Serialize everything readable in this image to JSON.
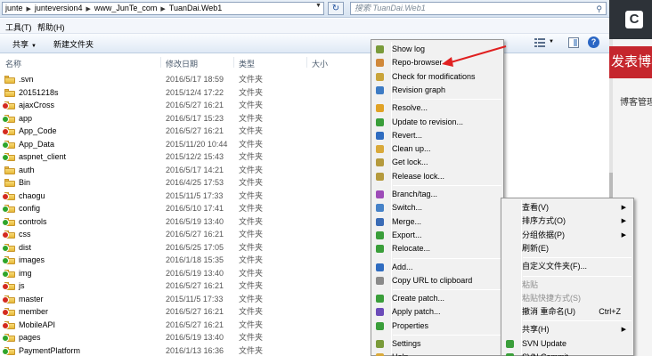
{
  "address": {
    "crumbs": [
      "junte",
      "junteversion4",
      "www_JunTe_com",
      "TuanDai.Web1"
    ],
    "search_placeholder": "搜索 TuanDai.Web1"
  },
  "menubar": {
    "items": [
      "工具(T)",
      "帮助(H)"
    ]
  },
  "toolbar": {
    "share": "共享",
    "new_folder": "新建文件夹"
  },
  "columns": {
    "name": "名称",
    "date": "修改日期",
    "type": "类型",
    "size": "大小"
  },
  "files": [
    {
      "name": ".svn",
      "date": "2016/5/17 18:59",
      "type": "文件夹",
      "badge": "none"
    },
    {
      "name": "20151218s",
      "date": "2015/12/4 17:22",
      "type": "文件夹",
      "badge": "none"
    },
    {
      "name": "ajaxCross",
      "date": "2016/5/27 16:21",
      "type": "文件夹",
      "badge": "mod"
    },
    {
      "name": "app",
      "date": "2016/5/17 15:23",
      "type": "文件夹",
      "badge": "ok"
    },
    {
      "name": "App_Code",
      "date": "2016/5/27 16:21",
      "type": "文件夹",
      "badge": "mod"
    },
    {
      "name": "App_Data",
      "date": "2015/11/20 10:44",
      "type": "文件夹",
      "badge": "ok"
    },
    {
      "name": "aspnet_client",
      "date": "2015/12/2 15:43",
      "type": "文件夹",
      "badge": "ok"
    },
    {
      "name": "auth",
      "date": "2016/5/17 14:21",
      "type": "文件夹",
      "badge": "none"
    },
    {
      "name": "Bin",
      "date": "2016/4/25 17:53",
      "type": "文件夹",
      "badge": "none"
    },
    {
      "name": "chaogu",
      "date": "2015/11/5 17:33",
      "type": "文件夹",
      "badge": "mod"
    },
    {
      "name": "config",
      "date": "2016/5/10 17:41",
      "type": "文件夹",
      "badge": "ok"
    },
    {
      "name": "controls",
      "date": "2016/5/19 13:40",
      "type": "文件夹",
      "badge": "ok"
    },
    {
      "name": "css",
      "date": "2016/5/27 16:21",
      "type": "文件夹",
      "badge": "mod"
    },
    {
      "name": "dist",
      "date": "2016/5/25 17:05",
      "type": "文件夹",
      "badge": "ok"
    },
    {
      "name": "images",
      "date": "2016/1/18 15:35",
      "type": "文件夹",
      "badge": "ok"
    },
    {
      "name": "img",
      "date": "2016/5/19 13:40",
      "type": "文件夹",
      "badge": "ok"
    },
    {
      "name": "js",
      "date": "2016/5/27 16:21",
      "type": "文件夹",
      "badge": "mod"
    },
    {
      "name": "master",
      "date": "2015/11/5 17:33",
      "type": "文件夹",
      "badge": "mod"
    },
    {
      "name": "member",
      "date": "2016/5/27 16:21",
      "type": "文件夹",
      "badge": "mod"
    },
    {
      "name": "MobileAPI",
      "date": "2016/5/27 16:21",
      "type": "文件夹",
      "badge": "mod"
    },
    {
      "name": "pages",
      "date": "2016/5/19 13:40",
      "type": "文件夹",
      "badge": "ok"
    },
    {
      "name": "PaymentPlatform",
      "date": "2016/1/13 16:36",
      "type": "文件夹",
      "badge": "ok"
    }
  ],
  "svn_menu": [
    {
      "label": "Show log",
      "icon": "show-log-icon",
      "color": "#7a9b3a"
    },
    {
      "label": "Repo-browser",
      "icon": "repo-browser-icon",
      "color": "#d0883a"
    },
    {
      "label": "Check for modifications",
      "icon": "check-modifications-icon",
      "color": "#c9a43a"
    },
    {
      "label": "Revision graph",
      "icon": "revision-graph-icon",
      "color": "#3d7bc4"
    },
    {
      "sep": true
    },
    {
      "label": "Resolve...",
      "icon": "resolve-icon",
      "color": "#e0a226"
    },
    {
      "label": "Update to revision...",
      "icon": "update-revision-icon",
      "color": "#3a9e3a"
    },
    {
      "label": "Revert...",
      "icon": "revert-icon",
      "color": "#2f6cc0"
    },
    {
      "label": "Clean up...",
      "icon": "clean-up-icon",
      "color": "#d9a93a"
    },
    {
      "label": "Get lock...",
      "icon": "get-lock-icon",
      "color": "#b59a3d"
    },
    {
      "label": "Release lock...",
      "icon": "release-lock-icon",
      "color": "#b59a3d"
    },
    {
      "sep": true
    },
    {
      "label": "Branch/tag...",
      "icon": "branch-tag-icon",
      "color": "#9d4bb8"
    },
    {
      "label": "Switch...",
      "icon": "switch-icon",
      "color": "#4682c8"
    },
    {
      "label": "Merge...",
      "icon": "merge-icon",
      "color": "#3a6bb5"
    },
    {
      "label": "Export...",
      "icon": "export-icon",
      "color": "#3a9e3a"
    },
    {
      "label": "Relocate...",
      "icon": "relocate-icon",
      "color": "#3a9e3a"
    },
    {
      "sep": true
    },
    {
      "label": "Add...",
      "icon": "add-icon",
      "color": "#2f6cc0"
    },
    {
      "label": "Copy URL to clipboard",
      "icon": "copy-url-icon",
      "color": "#8a8a8a"
    },
    {
      "sep": true
    },
    {
      "label": "Create patch...",
      "icon": "create-patch-icon",
      "color": "#3a9e3a"
    },
    {
      "label": "Apply patch...",
      "icon": "apply-patch-icon",
      "color": "#6b4bb8"
    },
    {
      "label": "Properties",
      "icon": "properties-icon",
      "color": "#3a9e3a"
    },
    {
      "sep": true
    },
    {
      "label": "Settings",
      "icon": "settings-icon",
      "color": "#7a9b3a"
    },
    {
      "label": "Help",
      "icon": "help-icon",
      "color": "#d9a93a"
    }
  ],
  "main_menu": [
    {
      "label": "查看(V)",
      "arrow": true
    },
    {
      "label": "排序方式(O)",
      "arrow": true
    },
    {
      "label": "分组依据(P)",
      "arrow": true
    },
    {
      "label": "刷新(E)"
    },
    {
      "sep": true
    },
    {
      "label": "自定义文件夹(F)..."
    },
    {
      "sep": true
    },
    {
      "label": "粘贴",
      "disabled": true
    },
    {
      "label": "粘贴快捷方式(S)",
      "disabled": true
    },
    {
      "label": "撤消 重命名(U)",
      "shortcut": "Ctrl+Z"
    },
    {
      "sep": true
    },
    {
      "label": "共享(H)",
      "arrow": true
    },
    {
      "label": "SVN Update",
      "icon": "svn-update-icon",
      "color": "#3a9e3a"
    },
    {
      "label": "SVN Commit...",
      "icon": "svn-commit-icon",
      "color": "#3a9e3a"
    }
  ],
  "background_window": {
    "banner": "发表博客",
    "subtitle": "博客管理"
  },
  "colors": {
    "accent_red": "#e02020",
    "banner_red": "#c5262d"
  }
}
